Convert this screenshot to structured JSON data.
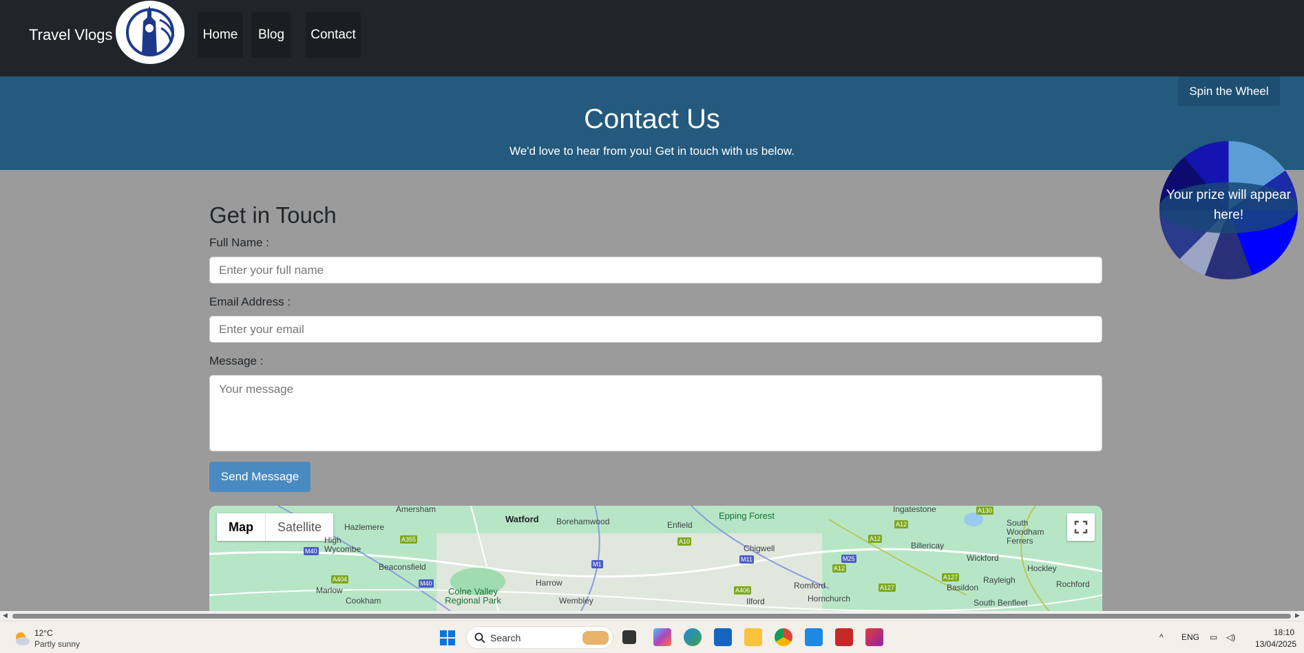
{
  "navbar": {
    "brand": "Travel Vlogs",
    "links": [
      "Home",
      "Blog",
      "Contact"
    ]
  },
  "hero": {
    "title": "Contact Us",
    "subtitle": "We'd love to hear from you! Get in touch with us below."
  },
  "spin_wheel": {
    "button_label": "Spin the Wheel",
    "prize_text": "Your prize will appear here!"
  },
  "form": {
    "title": "Get in Touch",
    "name_label": "Full Name :",
    "name_placeholder": "Enter your full name",
    "email_label": "Email Address :",
    "email_placeholder": "Enter your email",
    "message_label": "Message :",
    "message_placeholder": "Your message",
    "submit_label": "Send Message"
  },
  "map": {
    "map_tab": "Map",
    "satellite_tab": "Satellite",
    "places": [
      "Amersham",
      "Watford",
      "Borehamwood",
      "Enfield",
      "Epping Forest",
      "Ingatestone",
      "South Woodham Ferrers",
      "Hazlemere",
      "High Wycombe",
      "Beaconsfield",
      "Chigwell",
      "Billericay",
      "Wickford",
      "Hockley",
      "Rayleigh",
      "Rochford",
      "Marlow",
      "Cookham",
      "Colne Valley Regional Park",
      "Harrow",
      "Wembley",
      "Ilford",
      "Romford",
      "Hornchurch",
      "Basildon",
      "South Benfleet"
    ],
    "roads": [
      "M40",
      "A355",
      "A404",
      "M40",
      "M1",
      "A10",
      "M11",
      "A406",
      "M25",
      "A12",
      "A12",
      "A12",
      "A127",
      "A127",
      "A130"
    ]
  },
  "taskbar": {
    "temperature": "12°C",
    "weather": "Partly sunny",
    "search_placeholder": "Search",
    "language": "ENG",
    "time": "18:10",
    "date": "13/04/2025"
  }
}
